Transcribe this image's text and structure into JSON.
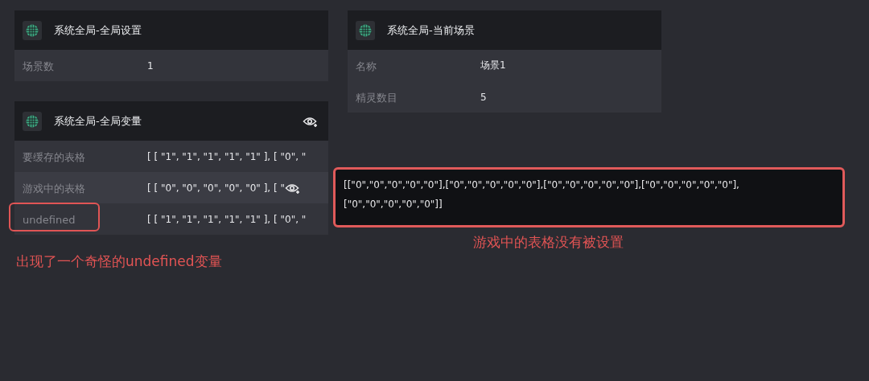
{
  "columns": [
    {
      "panels": [
        {
          "title": "系统全局-全局设置",
          "eye": false,
          "rows": [
            {
              "label": "场景数",
              "value": "1",
              "hovered": false,
              "highlighted": false
            }
          ]
        },
        {
          "title": "系统全局-全局变量",
          "eye": true,
          "rows": [
            {
              "label": "要缓存的表格",
              "value": "[ [ \"1\", \"1\", \"1\", \"1\", \"1\" ], [ \"0\", \"",
              "hovered": false,
              "highlighted": false
            },
            {
              "label": "游戏中的表格",
              "value": "[ [ \"0\", \"0\", \"0\", \"0\", \"0\" ], [ \"",
              "hovered": true,
              "highlighted": false
            },
            {
              "label": "undefined",
              "value": "[ [ \"1\", \"1\", \"1\", \"1\", \"1\" ], [ \"0\", \"",
              "hovered": false,
              "highlighted": true
            }
          ]
        }
      ]
    },
    {
      "panels": [
        {
          "title": "系统全局-当前场景",
          "eye": false,
          "rows": [
            {
              "label": "名称",
              "value": "场景1",
              "hovered": false,
              "highlighted": false
            },
            {
              "label": "精灵数目",
              "value": "5",
              "hovered": false,
              "highlighted": false
            }
          ]
        }
      ]
    }
  ],
  "tooltip": {
    "text": "[[\"0\",\"0\",\"0\",\"0\",\"0\"],[\"0\",\"0\",\"0\",\"0\",\"0\"],[\"0\",\"0\",\"0\",\"0\",\"0\"],[\"0\",\"0\",\"0\",\"0\",\"0\"],[\"0\",\"0\",\"0\",\"0\",\"0\"]]",
    "highlighted": true
  },
  "annotations": [
    {
      "text": "出现了一个奇怪的undefined变量",
      "kind": "left"
    },
    {
      "text": "游戏中的表格没有被设置",
      "kind": "tooltip"
    }
  ]
}
